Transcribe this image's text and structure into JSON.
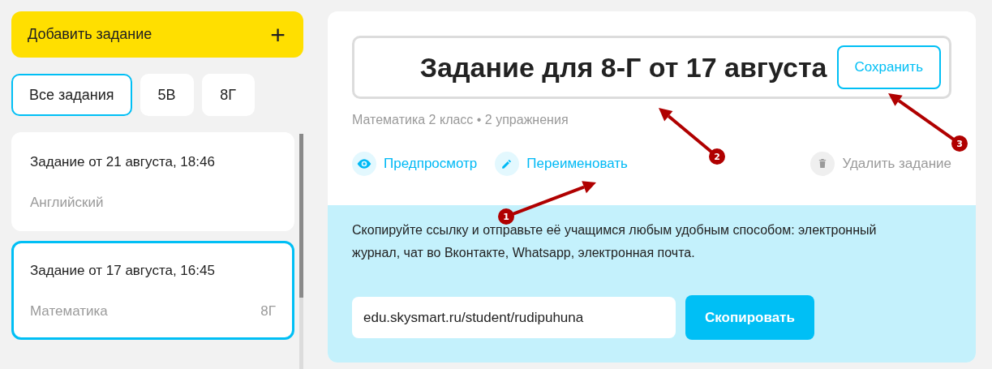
{
  "add_button": {
    "label": "Добавить задание",
    "icon": "+"
  },
  "filters": [
    {
      "label": "Все задания",
      "selected": true
    },
    {
      "label": "5В",
      "selected": false
    },
    {
      "label": "8Г",
      "selected": false
    }
  ],
  "tasks": [
    {
      "title": "Задание от 21 августа, 18:46",
      "subject": "Английский",
      "selected": false
    },
    {
      "title": "Задание от 17 августа, 16:45",
      "subject": "Математика",
      "class": "8Г",
      "selected": true
    }
  ],
  "editor": {
    "title": "Задание для 8-Г от 17 августа",
    "save": "Сохранить",
    "meta": "Математика 2 класс • 2 упражнения",
    "actions": [
      {
        "kind": "preview",
        "label": "Предпросмотр",
        "disabled": false
      },
      {
        "kind": "rename",
        "label": "Переименовать",
        "disabled": false
      },
      {
        "kind": "delete",
        "label": "Удалить задание",
        "disabled": true
      }
    ]
  },
  "share": {
    "text": "Скопируйте ссылку и отправьте её учащимся любым удобным способом: электронный журнал, чат во Вконтакте, Whatsapp, электронная почта.",
    "link": "edu.skysmart.ru/student/rudipuhuna",
    "copy": "Скопировать"
  },
  "annotations": [
    {
      "label": "1"
    },
    {
      "label": "2"
    },
    {
      "label": "3"
    }
  ]
}
